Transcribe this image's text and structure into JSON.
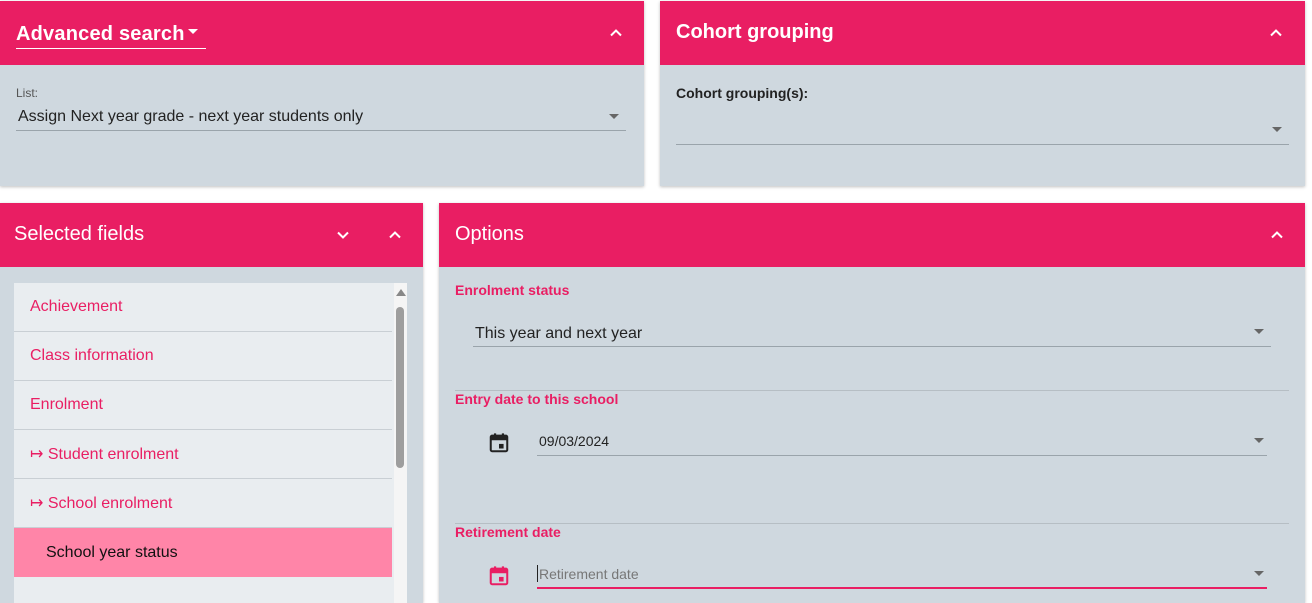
{
  "advanced_search": {
    "title": "Advanced search",
    "list_label": "List:",
    "list_value": "Assign Next year grade - next year students only"
  },
  "cohort": {
    "title": "Cohort grouping",
    "field_label": "Cohort grouping(s):",
    "field_value": ""
  },
  "selected_fields": {
    "title": "Selected fields",
    "items": [
      {
        "label": "Achievement"
      },
      {
        "label": "Class information"
      },
      {
        "label": "Enrolment"
      },
      {
        "label": "↦ Student enrolment"
      },
      {
        "label": "↦ School enrolment"
      },
      {
        "label": "School year status"
      }
    ],
    "selected_index": 5
  },
  "options": {
    "title": "Options",
    "enrolment_status_label": "Enrolment status",
    "enrolment_status_value": "This year and next year",
    "entry_date_label": "Entry date to this school",
    "entry_date_value": "09/03/2024",
    "retirement_date_label": "Retirement date",
    "retirement_date_placeholder": "Retirement date"
  },
  "icons": {
    "collapse": "chevron-up-icon",
    "expand": "chevron-down-icon",
    "calendar": "calendar-icon"
  },
  "colors": {
    "accent": "#e91e63",
    "panel_bg": "#cfd8df",
    "selected_item": "#ff85a8"
  }
}
